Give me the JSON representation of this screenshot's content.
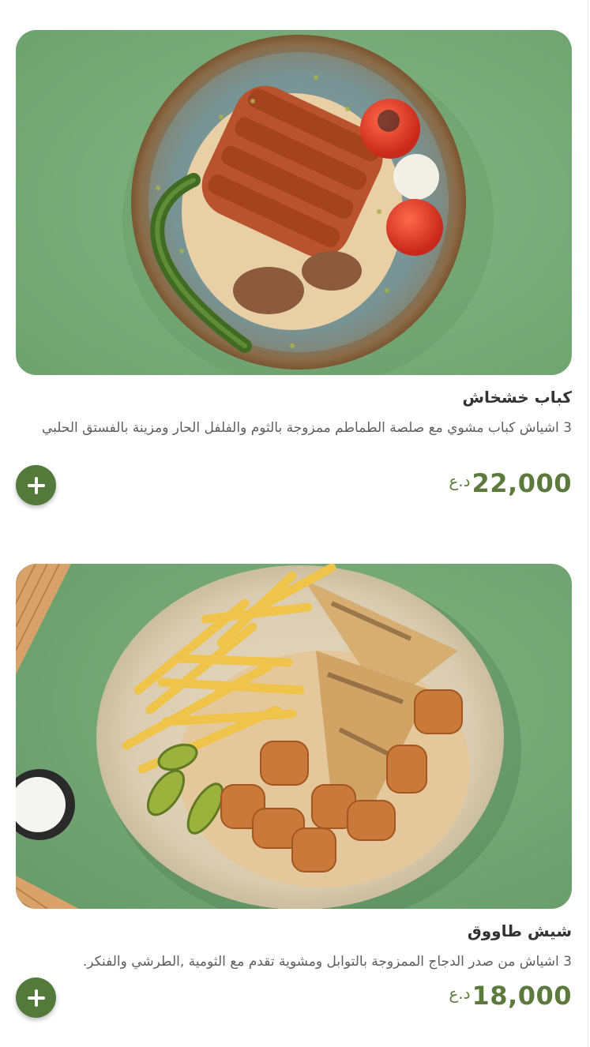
{
  "colors": {
    "accent": "#537a3a",
    "price": "#5b7a3c",
    "title": "#333333",
    "description": "#5e5e5e",
    "photo_background": "#7fb07c"
  },
  "items": [
    {
      "name": "كباب خشخاش",
      "description": "3 اشياش كباب مشوي مع صلصة الطماطم ممزوجة بالثوم والفلفل الحار ومزينة بالفستق الحلبي",
      "price": "22,000",
      "currency": "د.ع",
      "add_icon": "plus-icon"
    },
    {
      "name": "شيش طاووق",
      "description": "3 اشياش من صدر الدجاج الممزوجة بالتوابل ومشوية تقدم مع الثومية ,الطرشي والفنكر.",
      "price": "18,000",
      "currency": "د.ع",
      "add_icon": "plus-icon"
    }
  ]
}
